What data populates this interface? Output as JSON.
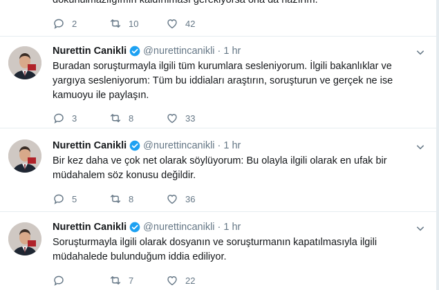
{
  "partial": {
    "text": "dokunulmazlığımın kaldırılması gerekiyorsa ona da hazırım.",
    "replies": "2",
    "retweets": "10",
    "likes": "42"
  },
  "tweets": [
    {
      "name": "Nurettin Canikli",
      "handle": "@nurettincanikli",
      "dot": "·",
      "time": "1 hr",
      "lines": [
        "Buradan soruşturmayla ilgili tüm kurumlara sesleniyorum. İlgili bakanlıklar ve",
        "yargıya sesleniyorum: Tüm bu iddiaları araştırın, soruşturun ve gerçek ne ise",
        "kamuoyu ile paylaşın."
      ],
      "replies": "3",
      "retweets": "8",
      "likes": "33"
    },
    {
      "name": "Nurettin Canikli",
      "handle": "@nurettincanikli",
      "dot": "·",
      "time": "1 hr",
      "lines": [
        "Bir kez daha ve çok net olarak söylüyorum: Bu olayla ilgili olarak en ufak bir",
        "müdahalem söz konusu değildir."
      ],
      "replies": "5",
      "retweets": "8",
      "likes": "36"
    },
    {
      "name": "Nurettin Canikli",
      "handle": "@nurettincanikli",
      "dot": "·",
      "time": "1 hr",
      "lines": [
        "Soruşturmayla ilgili olarak dosyanın ve soruşturmanın kapatılmasıyla ilgili",
        "müdahalede bulunduğum iddia ediliyor."
      ],
      "replies": "",
      "retweets": "7",
      "likes": "22"
    }
  ],
  "icons": {
    "reply": "reply-icon",
    "retweet": "retweet-icon",
    "like": "heart-icon",
    "verified": "verified-badge-icon",
    "more": "chevron-down-icon"
  },
  "colors": {
    "text": "#14171a",
    "secondary": "#657786",
    "verified": "#1da1f2",
    "divider": "#e6ecf0"
  }
}
